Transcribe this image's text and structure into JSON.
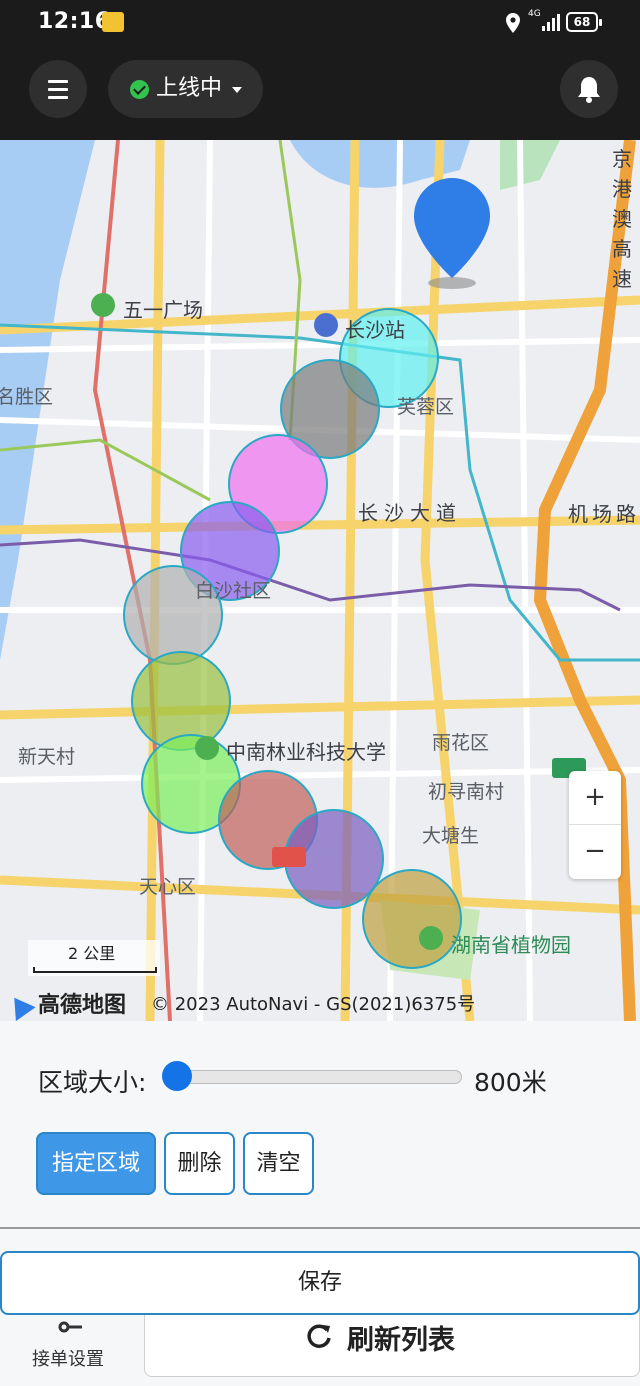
{
  "status_bar": {
    "time": "12:16",
    "network": "4G",
    "battery": "68"
  },
  "header": {
    "status_label": "上线中"
  },
  "map": {
    "places": {
      "wuyi_square": "五一广场",
      "changsha_station": "长沙站",
      "mingsheng_district": "名胜区",
      "furong_district": "芙蓉区",
      "changsha_avenue": "长沙大道",
      "airport_road": "机场路",
      "baisha_community": "白沙社区",
      "xintian_village": "新天村",
      "forestry_university": "中南林业科技大学",
      "yuhua_district": "雨花区",
      "chuxun_south_village": "初寻南村",
      "datang_sheng": "大塘生",
      "tianxin_district": "天心区",
      "botanical_garden": "湖南省植物园",
      "highway_label": "京港澳高速"
    },
    "zoom_in_label": "+",
    "zoom_out_label": "−",
    "scale_label": "2 公里",
    "logo_text": "高德地图",
    "copyright": "© 2023 AutoNavi - GS(2021)6375号",
    "zone_colors": [
      "#5ff0f0",
      "#7a7a7a",
      "#f070f0",
      "#8a5cf0",
      "#b0b0b0",
      "#9ac040",
      "#7af05a",
      "#c0605a",
      "#7a5cc0",
      "#c0a040"
    ],
    "pin_color": "#2f7de6"
  },
  "panel": {
    "slider_label": "区域大小:",
    "slider_value": "800米",
    "slider_level": 0,
    "btn_assign": "指定区域",
    "btn_delete": "删除",
    "btn_clear": "清空"
  },
  "bottom": {
    "save_label": "保存",
    "tab_settings_label": "接单设置",
    "refresh_label": "刷新列表"
  }
}
